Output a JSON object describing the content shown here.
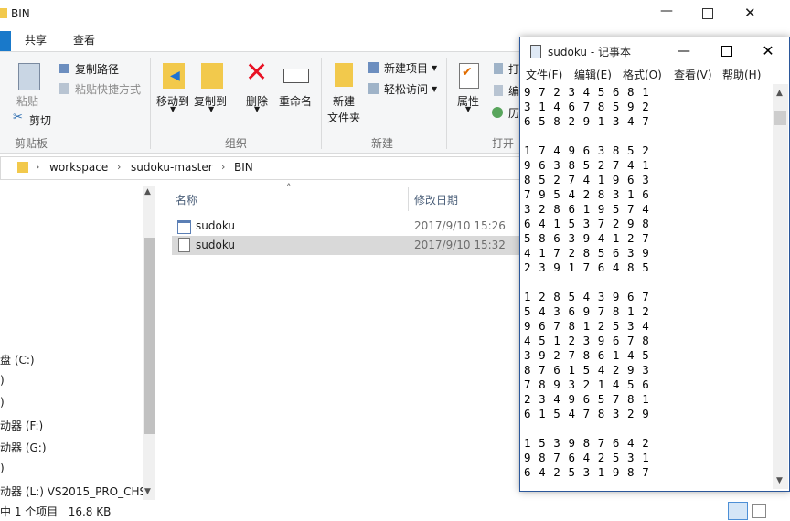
{
  "explorer": {
    "window_title": "BIN",
    "tabs": [
      "共享",
      "查看"
    ],
    "ribbon": {
      "clipboard": {
        "paste": "粘贴",
        "copy_path": "复制路径",
        "paste_shortcut": "粘贴快捷方式",
        "cut": "剪切",
        "group": "剪贴板"
      },
      "organize": {
        "move_to": "移动到",
        "copy_to": "复制到",
        "delete": "删除",
        "rename": "重命名",
        "group": "组织"
      },
      "new": {
        "new_folder_l1": "新建",
        "new_folder_l2": "文件夹",
        "new_item": "新建项目",
        "easy_access": "轻松访问",
        "group": "新建"
      },
      "open": {
        "properties": "属性",
        "open_item": "打",
        "edit_item": "编",
        "history_item": "历",
        "group": "打开"
      }
    },
    "breadcrumb": [
      "workspace",
      "sudoku-master",
      "BIN"
    ],
    "columns": {
      "name": "名称",
      "date": "修改日期"
    },
    "files": [
      {
        "name": "sudoku",
        "date": "2017/9/10 15:26",
        "icon": "exe-icon",
        "selected": false
      },
      {
        "name": "sudoku",
        "date": "2017/9/10 15:32",
        "icon": "text-file-icon",
        "selected": true
      }
    ],
    "nav_items": [
      "盘 (C:)",
      ")",
      ")",
      "动器 (F:)",
      "动器 (G:)",
      ")",
      "动器 (L:) VS2015_PRO_CHS"
    ],
    "status": "中 1 个项目   16.8 KB"
  },
  "notepad": {
    "title": "sudoku - 记事本",
    "menu": [
      "文件(F)",
      "编辑(E)",
      "格式(O)",
      "查看(V)",
      "帮助(H)"
    ],
    "lines": [
      "9 7 2 3 4 5 6 8 1",
      "3 1 4 6 7 8 5 9 2",
      "6 5 8 2 9 1 3 4 7",
      "",
      "1 7 4 9 6 3 8 5 2",
      "9 6 3 8 5 2 7 4 1",
      "8 5 2 7 4 1 9 6 3",
      "7 9 5 4 2 8 3 1 6",
      "3 2 8 6 1 9 5 7 4",
      "6 4 1 5 3 7 2 9 8",
      "5 8 6 3 9 4 1 2 7",
      "4 1 7 2 8 5 6 3 9",
      "2 3 9 1 7 6 4 8 5",
      "",
      "1 2 8 5 4 3 9 6 7",
      "5 4 3 6 9 7 8 1 2",
      "9 6 7 8 1 2 5 3 4",
      "4 5 1 2 3 9 6 7 8",
      "3 9 2 7 8 6 1 4 5",
      "8 7 6 1 5 4 2 9 3",
      "7 8 9 3 2 1 4 5 6",
      "2 3 4 9 6 5 7 8 1",
      "6 1 5 4 7 8 3 2 9",
      "",
      "1 5 3 9 8 7 6 4 2",
      "9 8 7 6 4 2 5 3 1",
      "6 4 2 5 3 1 9 8 7"
    ]
  },
  "colors": {
    "accent": "#2b579a",
    "selected_row": "#d9d9d9",
    "ribbon_bg": "#f5f6f7",
    "delete_red": "#e81123"
  }
}
